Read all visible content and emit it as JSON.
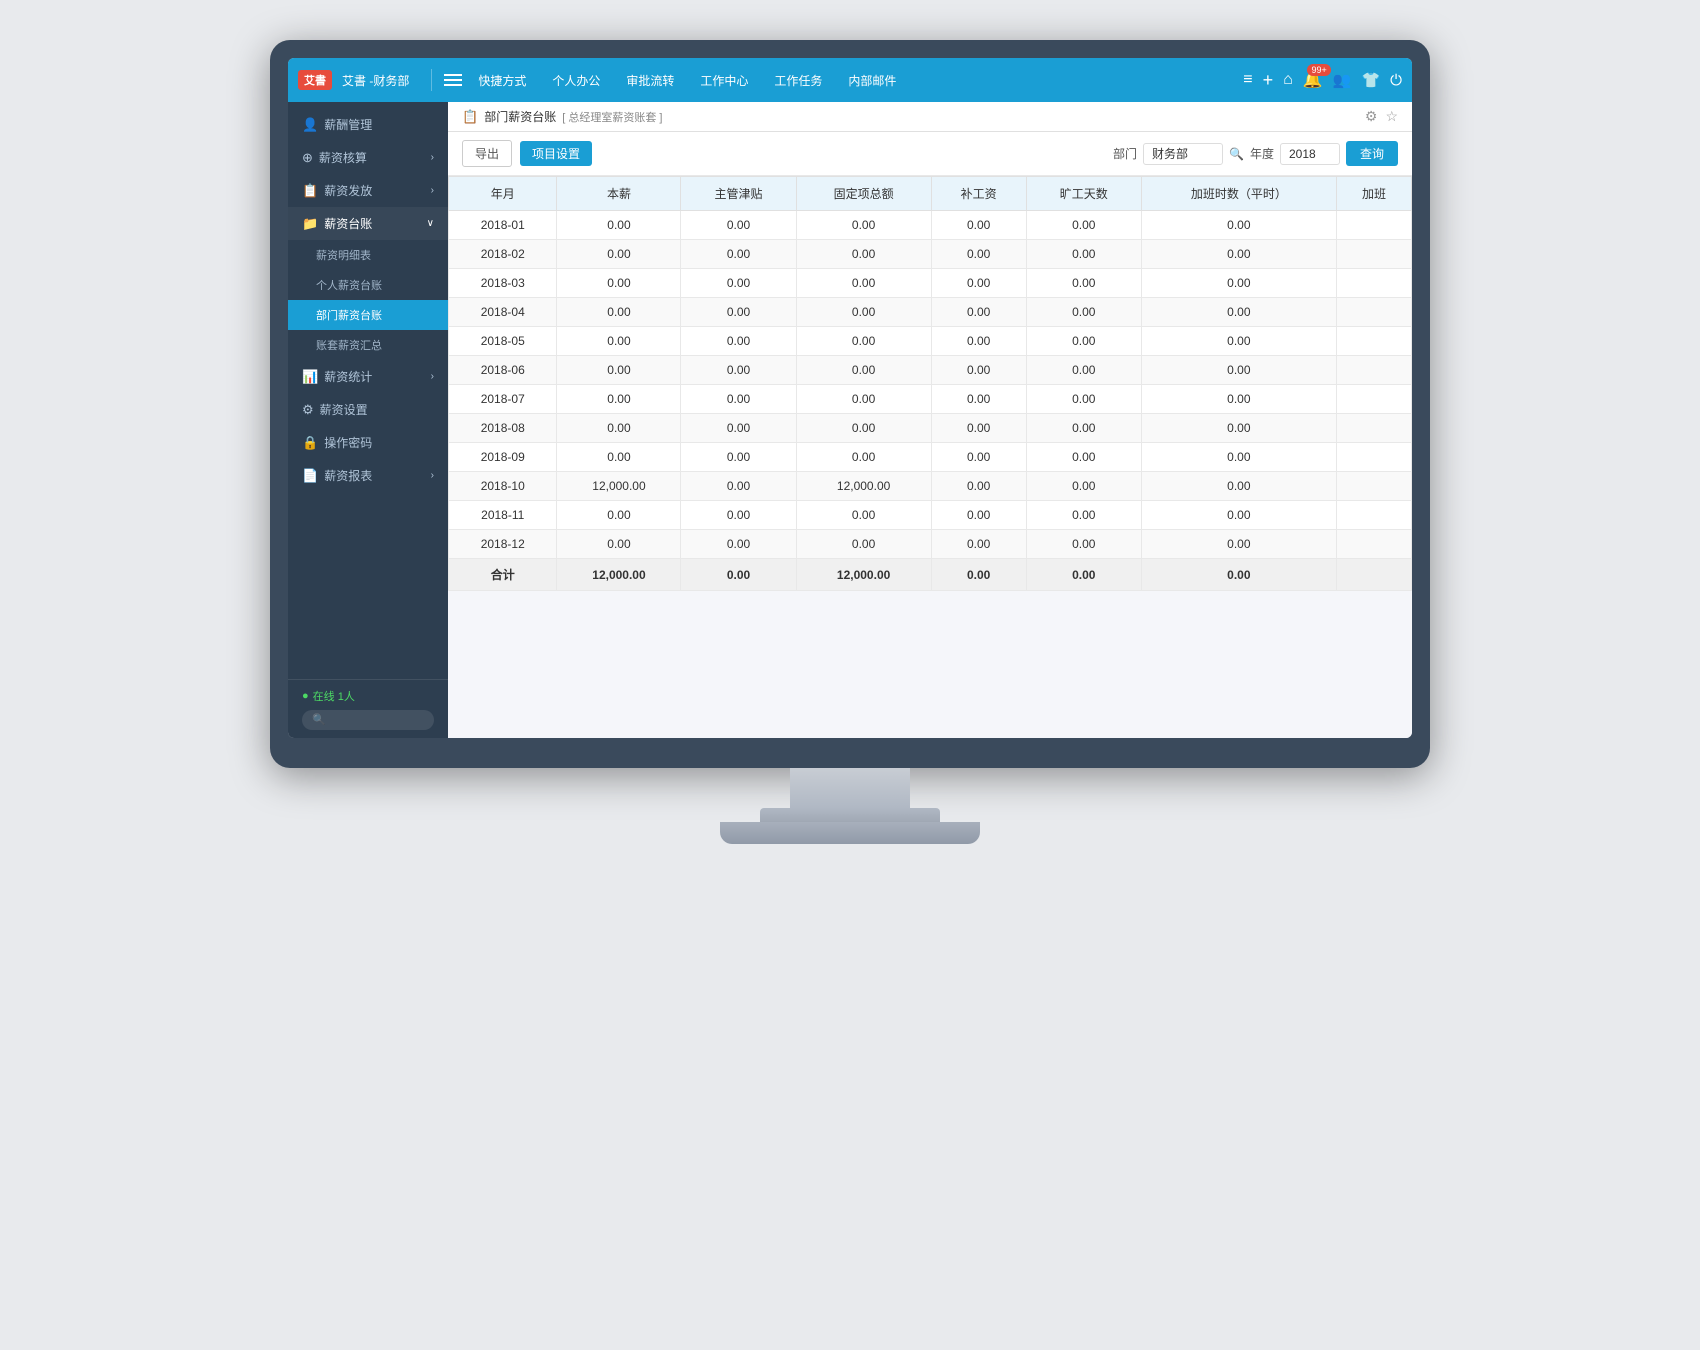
{
  "brand": {
    "logo": "艾書",
    "title": "艾書 -财务部"
  },
  "topbar": {
    "menu_icon": "≡",
    "nav_items": [
      "快捷方式",
      "个人办公",
      "审批流转",
      "工作中心",
      "工作任务",
      "内部邮件"
    ],
    "icons": {
      "notification_badge": "99+",
      "plus": "+",
      "home": "⌂",
      "bell": "🔔",
      "user": "👤",
      "shirt": "👕",
      "power": "⏻"
    }
  },
  "sidebar": {
    "items": [
      {
        "icon": "👤",
        "label": "薪酬管理",
        "has_arrow": false
      },
      {
        "icon": "⊕",
        "label": "薪资核算",
        "has_arrow": true
      },
      {
        "icon": "📋",
        "label": "薪资发放",
        "has_arrow": true
      },
      {
        "icon": "📁",
        "label": "薪资台账",
        "has_arrow": true,
        "active": true,
        "sub_items": [
          {
            "label": "薪资明细表",
            "active": false
          },
          {
            "label": "个人薪资台账",
            "active": false
          },
          {
            "label": "部门薪资台账",
            "active": true
          },
          {
            "label": "账套薪资汇总",
            "active": false
          }
        ]
      },
      {
        "icon": "📊",
        "label": "薪资统计",
        "has_arrow": true
      },
      {
        "icon": "⚙",
        "label": "薪资设置",
        "has_arrow": false
      },
      {
        "icon": "🔒",
        "label": "操作密码",
        "has_arrow": false
      },
      {
        "icon": "📄",
        "label": "薪资报表",
        "has_arrow": true
      }
    ],
    "online": {
      "label": "在线 1人"
    },
    "search_placeholder": "🔍"
  },
  "breadcrumb": {
    "icon": "📋",
    "main": "部门薪资台账",
    "sub": "[ 总经理室薪资账套 ]"
  },
  "toolbar": {
    "export_label": "导出",
    "settings_label": "项目设置",
    "department_label": "部门",
    "department_value": "财务部",
    "year_label": "年度",
    "year_value": "2018",
    "query_label": "查询"
  },
  "table": {
    "headers": [
      "年月",
      "本薪",
      "主管津贴",
      "固定项总额",
      "补工资",
      "旷工天数",
      "加班时数（平时）",
      "加班"
    ],
    "rows": [
      {
        "month": "2018-01",
        "base": "0.00",
        "mgr_allowance": "0.00",
        "fixed_total": "0.00",
        "supplement": "0.00",
        "absent_days": "0.00",
        "overtime_regular": "0.00"
      },
      {
        "month": "2018-02",
        "base": "0.00",
        "mgr_allowance": "0.00",
        "fixed_total": "0.00",
        "supplement": "0.00",
        "absent_days": "0.00",
        "overtime_regular": "0.00"
      },
      {
        "month": "2018-03",
        "base": "0.00",
        "mgr_allowance": "0.00",
        "fixed_total": "0.00",
        "supplement": "0.00",
        "absent_days": "0.00",
        "overtime_regular": "0.00"
      },
      {
        "month": "2018-04",
        "base": "0.00",
        "mgr_allowance": "0.00",
        "fixed_total": "0.00",
        "supplement": "0.00",
        "absent_days": "0.00",
        "overtime_regular": "0.00"
      },
      {
        "month": "2018-05",
        "base": "0.00",
        "mgr_allowance": "0.00",
        "fixed_total": "0.00",
        "supplement": "0.00",
        "absent_days": "0.00",
        "overtime_regular": "0.00"
      },
      {
        "month": "2018-06",
        "base": "0.00",
        "mgr_allowance": "0.00",
        "fixed_total": "0.00",
        "supplement": "0.00",
        "absent_days": "0.00",
        "overtime_regular": "0.00"
      },
      {
        "month": "2018-07",
        "base": "0.00",
        "mgr_allowance": "0.00",
        "fixed_total": "0.00",
        "supplement": "0.00",
        "absent_days": "0.00",
        "overtime_regular": "0.00"
      },
      {
        "month": "2018-08",
        "base": "0.00",
        "mgr_allowance": "0.00",
        "fixed_total": "0.00",
        "supplement": "0.00",
        "absent_days": "0.00",
        "overtime_regular": "0.00"
      },
      {
        "month": "2018-09",
        "base": "0.00",
        "mgr_allowance": "0.00",
        "fixed_total": "0.00",
        "supplement": "0.00",
        "absent_days": "0.00",
        "overtime_regular": "0.00"
      },
      {
        "month": "2018-10",
        "base": "12,000.00",
        "mgr_allowance": "0.00",
        "fixed_total": "12,000.00",
        "supplement": "0.00",
        "absent_days": "0.00",
        "overtime_regular": "0.00"
      },
      {
        "month": "2018-11",
        "base": "0.00",
        "mgr_allowance": "0.00",
        "fixed_total": "0.00",
        "supplement": "0.00",
        "absent_days": "0.00",
        "overtime_regular": "0.00"
      },
      {
        "month": "2018-12",
        "base": "0.00",
        "mgr_allowance": "0.00",
        "fixed_total": "0.00",
        "supplement": "0.00",
        "absent_days": "0.00",
        "overtime_regular": "0.00"
      }
    ],
    "total_row": {
      "label": "合计",
      "base": "12,000.00",
      "mgr_allowance": "0.00",
      "fixed_total": "12,000.00",
      "supplement": "0.00",
      "absent_days": "0.00",
      "overtime_regular": "0.00"
    }
  }
}
